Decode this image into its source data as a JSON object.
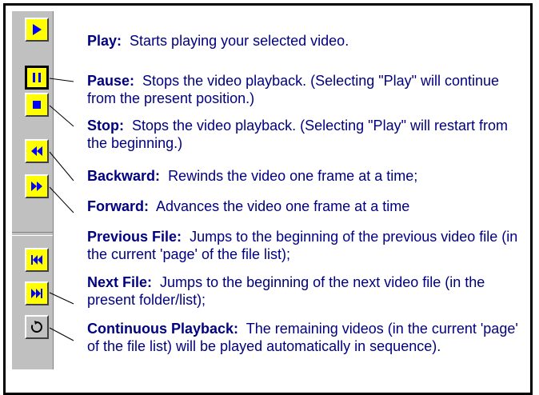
{
  "help": {
    "play": {
      "title": "Play:",
      "desc": "Starts playing your selected video.",
      "icon": "play-icon"
    },
    "pause": {
      "title": "Pause:",
      "desc": "Stops the video playback.  (Selecting \"Play\" will continue from the present position.)",
      "icon": "pause-icon"
    },
    "stop": {
      "title": "Stop:",
      "desc": "Stops the video playback.  (Selecting \"Play\" will restart from the beginning.)",
      "icon": "stop-icon"
    },
    "backward": {
      "title": "Backward:",
      "desc": "Rewinds the video one frame at a time;",
      "icon": "rewind-icon"
    },
    "forward": {
      "title": "Forward:",
      "desc": "Advances the video one frame at a time",
      "icon": "fast-forward-icon"
    },
    "previous_file": {
      "title": "Previous File:",
      "desc": "Jumps to the beginning of the previous video file (in the current 'page' of the file list);",
      "icon": "skip-previous-icon"
    },
    "next_file": {
      "title": "Next File:",
      "desc": "Jumps to the beginning of the next video file (in the present folder/list);",
      "icon": "skip-next-icon"
    },
    "continuous": {
      "title": "Continuous Playback:",
      "desc": "The remaining videos (in the current 'page' of the file list) will be played automatically in sequence).",
      "icon": "loop-icon"
    }
  },
  "colors": {
    "text": "#000080",
    "button": "#ffff00",
    "icon": "#0000ff",
    "toolbar": "#c0c0c0"
  }
}
